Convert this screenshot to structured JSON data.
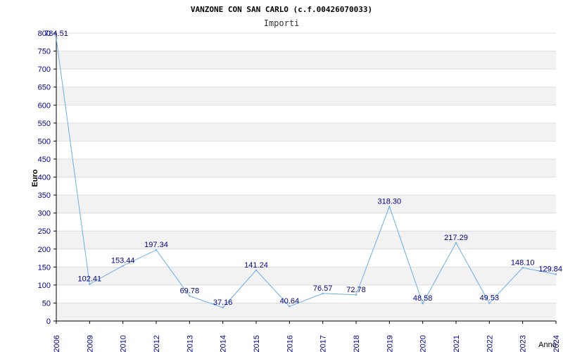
{
  "chart_data": {
    "type": "line",
    "title": "VANZONE CON SAN CARLO (c.f.00426070033)",
    "subtitle": "Importi",
    "xlabel": "Anno",
    "ylabel": "Euro",
    "categories": [
      "2006",
      "2009",
      "2010",
      "2012",
      "2013",
      "2014",
      "2015",
      "2016",
      "2017",
      "2018",
      "2019",
      "2020",
      "2021",
      "2022",
      "2023",
      "2024"
    ],
    "series": [
      {
        "values": [
          784.51,
          102.41,
          153.44,
          197.34,
          69.78,
          37.16,
          141.24,
          40.64,
          76.57,
          72.78,
          318.3,
          48.58,
          217.29,
          49.53,
          148.1,
          129.84
        ],
        "labels": [
          "784.51",
          "102.41",
          "153.44",
          "197.34",
          "69.78",
          "37.16",
          "141.24",
          "40.64",
          "76.57",
          "72.78",
          "318.30",
          "48.58",
          "217.29",
          "49.53",
          "148.10",
          "129.84"
        ]
      }
    ],
    "ylim": [
      0,
      800
    ],
    "yticks": [
      "0",
      "50",
      "100",
      "150",
      "200",
      "250",
      "300",
      "350",
      "400",
      "450",
      "500",
      "550",
      "600",
      "650",
      "700",
      "750",
      "800"
    ],
    "grid": true,
    "colors": {
      "line": "#6aaeea",
      "text": "#00008b",
      "band": "#f2f2f2",
      "grid": "#dddddd",
      "axis": "#000000"
    }
  }
}
